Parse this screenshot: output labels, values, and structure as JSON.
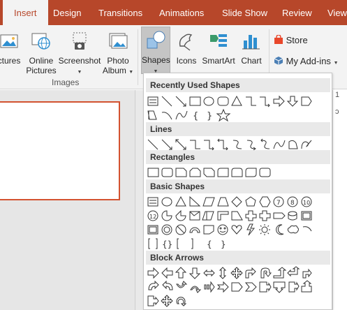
{
  "tabs": [
    {
      "label": "Insert",
      "active": true
    },
    {
      "label": "Design"
    },
    {
      "label": "Transitions"
    },
    {
      "label": "Animations"
    },
    {
      "label": "Slide Show"
    },
    {
      "label": "Review"
    },
    {
      "label": "View"
    }
  ],
  "ribbon": {
    "images_group": {
      "label": "Images",
      "buttons": {
        "pictures": "ctures",
        "online_pictures_line1": "Online",
        "online_pictures_line2": "Pictures",
        "screenshot": "Screenshot",
        "photo_album_line1": "Photo",
        "photo_album_line2": "Album"
      }
    },
    "illustrations": {
      "shapes": "Shapes",
      "icons": "Icons",
      "smartart": "SmartArt",
      "chart": "Chart"
    },
    "addins": {
      "store": "Store",
      "my_addins": "My Add-ins"
    }
  },
  "gallery": {
    "categories": {
      "recent": "Recently Used Shapes",
      "lines": "Lines",
      "rectangles": "Rectangles",
      "basic": "Basic Shapes",
      "block_arrows": "Block Arrows"
    }
  },
  "colors": {
    "accent": "#b7472a",
    "slide_border": "#d35230",
    "store_icon": "#e8472b"
  }
}
